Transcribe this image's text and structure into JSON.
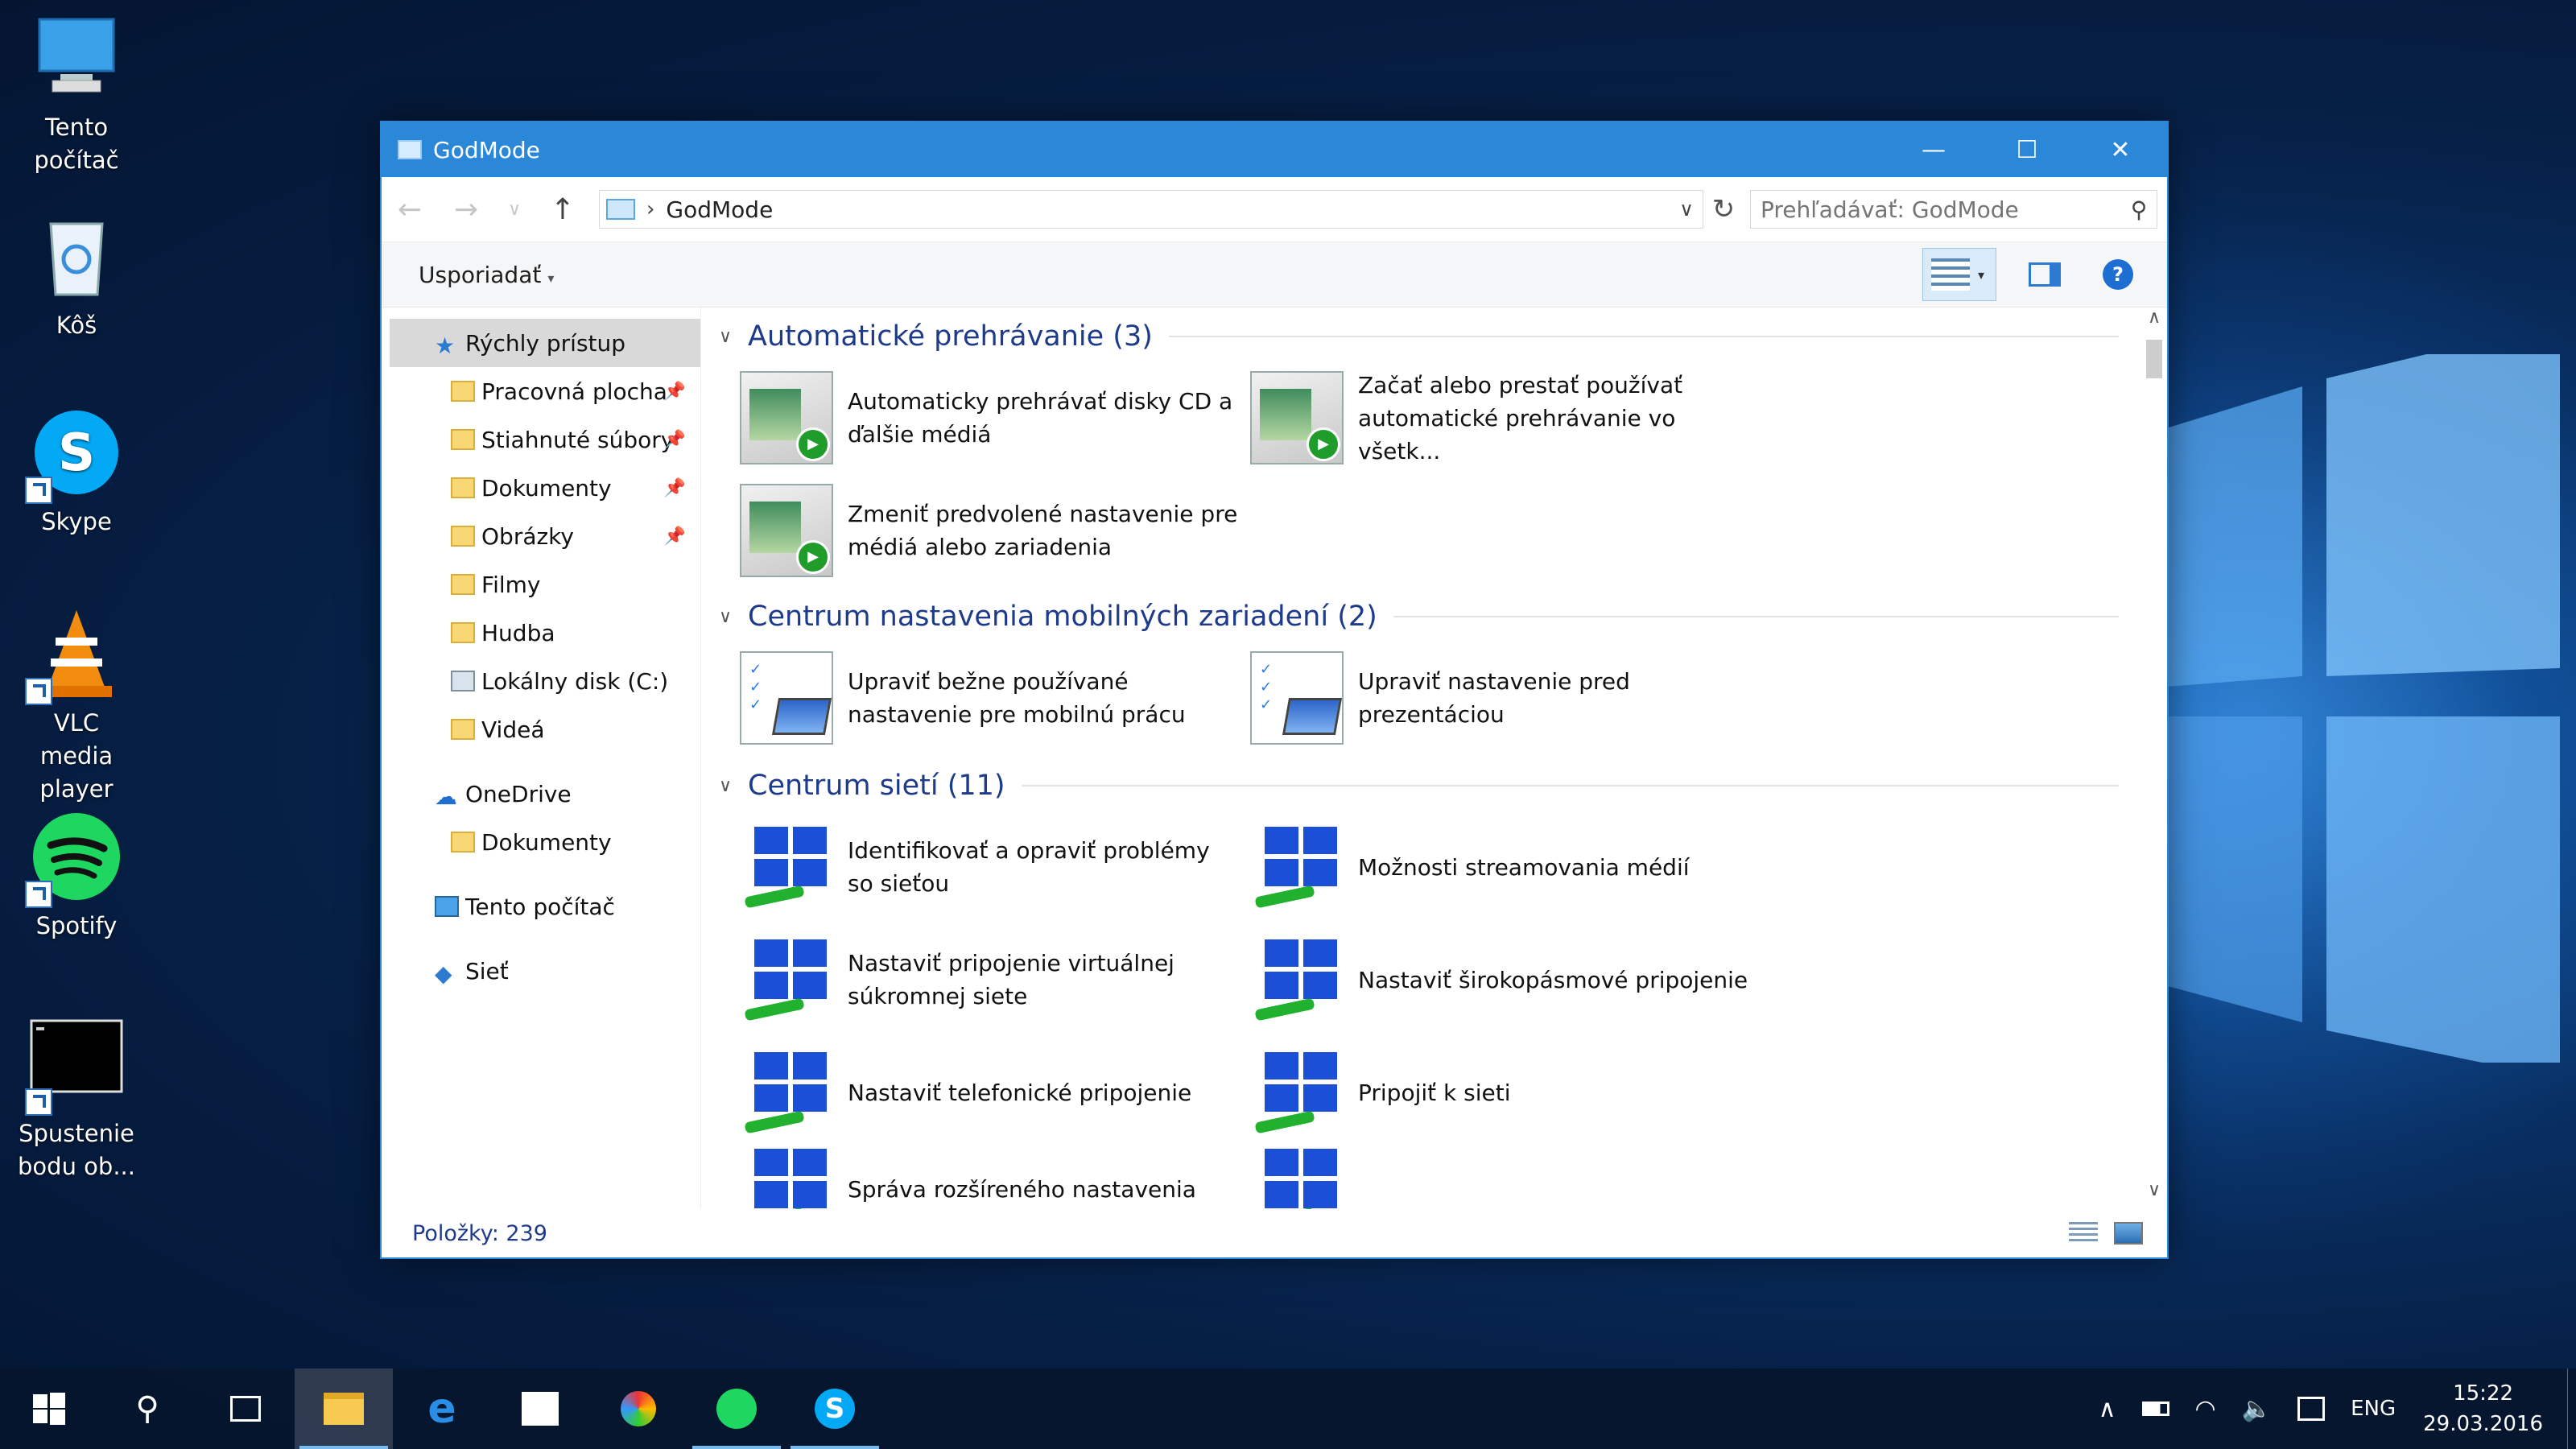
{
  "desktop": {
    "icons": [
      {
        "label": "Tento počítač"
      },
      {
        "label": "Kôš"
      },
      {
        "label": "Skype"
      },
      {
        "label": "VLC media player"
      },
      {
        "label": "Spotify"
      },
      {
        "label": "Spustenie bodu ob..."
      }
    ]
  },
  "window": {
    "title": "GodMode",
    "controls": {
      "minimize": "—",
      "maximize": "☐",
      "close": "✕"
    }
  },
  "address": {
    "path": "GodMode",
    "search_placeholder": "Prehľadávať: GodMode"
  },
  "toolbar": {
    "organize_label": "Usporiadať"
  },
  "nav": {
    "quick_access": "Rýchly prístup",
    "items": [
      {
        "label": "Pracovná plocha",
        "pinned": true
      },
      {
        "label": "Stiahnuté súbory",
        "pinned": true
      },
      {
        "label": "Dokumenty",
        "pinned": true
      },
      {
        "label": "Obrázky",
        "pinned": true
      },
      {
        "label": "Filmy",
        "pinned": false
      },
      {
        "label": "Hudba",
        "pinned": false
      },
      {
        "label": "Lokálny disk (C:)",
        "pinned": false
      },
      {
        "label": "Videá",
        "pinned": false
      }
    ],
    "onedrive": "OneDrive",
    "onedrive_items": [
      {
        "label": "Dokumenty"
      }
    ],
    "this_pc": "Tento počítač",
    "network": "Sieť"
  },
  "groups": [
    {
      "title": "Automatické prehrávanie (3)",
      "items": [
        {
          "line1": "Automaticky prehrávať disky CD a",
          "line2": "ďalšie médiá",
          "icon": "autoplay-icon"
        },
        {
          "line1": "Začať alebo prestať používať",
          "line2": "automatické prehrávanie vo všetk...",
          "icon": "autoplay-icon"
        },
        {
          "line1": "Zmeniť predvolené nastavenie pre",
          "line2": "médiá alebo zariadenia",
          "icon": "autoplay-icon"
        }
      ]
    },
    {
      "title": "Centrum nastavenia mobilných zariadení (2)",
      "items": [
        {
          "line1": "Upraviť bežne používané",
          "line2": "nastavenie pre mobilnú prácu",
          "icon": "mobility-center-icon"
        },
        {
          "line1": "Upraviť nastavenie pred",
          "line2": "prezentáciou",
          "icon": "mobility-center-icon"
        }
      ]
    },
    {
      "title": "Centrum sietí (11)",
      "items": [
        {
          "line1": "Identifikovať a opraviť problémy",
          "line2": "so sieťou",
          "icon": "network-icon"
        },
        {
          "line1": "Možnosti streamovania médií",
          "line2": "",
          "icon": "network-icon"
        },
        {
          "line1": "Nastaviť pripojenie virtuálnej",
          "line2": "súkromnej siete",
          "icon": "network-icon"
        },
        {
          "line1": "Nastaviť širokopásmové pripojenie",
          "line2": "",
          "icon": "network-icon"
        },
        {
          "line1": "Nastaviť telefonické pripojenie",
          "line2": "",
          "icon": "network-icon"
        },
        {
          "line1": "Pripojiť k sieti",
          "line2": "",
          "icon": "network-icon"
        },
        {
          "line1": "Správa rozšíreného nastavenia",
          "line2": "",
          "icon": "network-icon"
        }
      ]
    }
  ],
  "status": {
    "items_count": "Položky: 239"
  },
  "taskbar": {
    "language": "ENG",
    "time": "15:22",
    "date": "29.03.2016"
  }
}
